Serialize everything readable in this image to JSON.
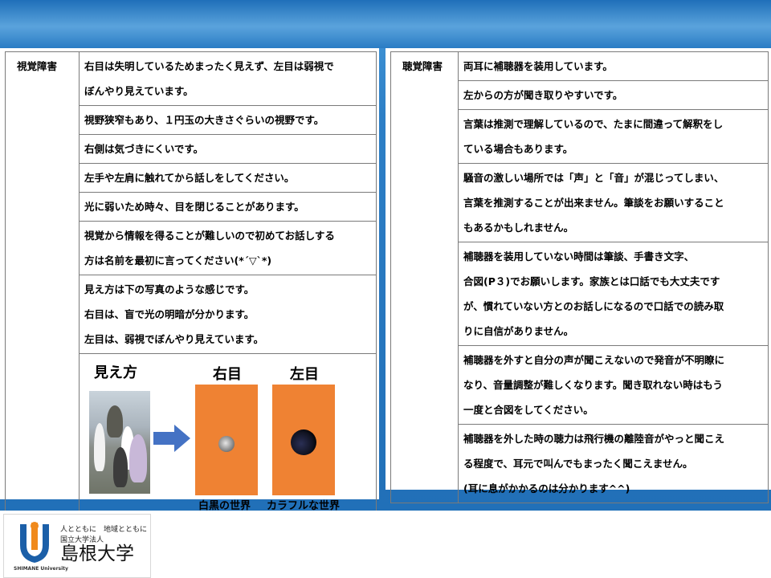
{
  "left_table": {
    "header": "視覚障害",
    "rows": [
      {
        "lines": [
          "右目は失明しているためまったく見えず、左目は弱視で",
          "ぼんやり見えています。"
        ]
      },
      {
        "lines": [
          "視野狭窄もあり、１円玉の大きさぐらいの視野です。"
        ]
      },
      {
        "lines": [
          "右側は気づきにくいです。"
        ]
      },
      {
        "lines": [
          "左手や左肩に触れてから話しをしてください。"
        ]
      },
      {
        "lines": [
          "光に弱いため時々、目を閉じることがあります。"
        ]
      },
      {
        "lines": [
          "視覚から情報を得ることが難しいので初めてお話しする",
          "方は名前を最初に言ってください(*´▽`*)"
        ]
      },
      {
        "lines": [
          "見え方は下の写真のような感じです。",
          "右目は、盲で光の明暗が分かります。",
          "左目は、弱視でぼんやり見えています。"
        ]
      }
    ],
    "illustration": {
      "title": "見え方",
      "right_label": "右目",
      "left_label": "左目",
      "right_caption": "白黒の世界",
      "left_caption": "カラフルな世界",
      "box_color": "#ef8233"
    }
  },
  "right_table": {
    "header": "聴覚障害",
    "rows": [
      {
        "lines": [
          "両耳に補聴器を装用しています。"
        ]
      },
      {
        "lines": [
          "左からの方が聞き取りやすいです。"
        ]
      },
      {
        "lines": [
          "言葉は推測で理解しているので、たまに間違って解釈をし",
          "ている場合もあります。"
        ]
      },
      {
        "lines": [
          "騒音の激しい場所では「声」と「音」が混じってしまい、",
          "言葉を推測することが出来ません。筆談をお願いすること",
          "もあるかもしれません。"
        ]
      },
      {
        "lines": [
          "補聴器を装用していない時間は筆談、手書き文字、",
          "合図(P３)でお願いします。家族とは口話でも大丈夫です",
          "が、慣れていない方とのお話しになるので口話での読み取",
          "りに自信がありません。"
        ]
      },
      {
        "lines": [
          "補聴器を外すと自分の声が聞こえないので発音が不明瞭に",
          "なり、音量調整が難しくなります。聞き取れない時はもう",
          "一度と合図をしてください。"
        ]
      },
      {
        "lines": [
          "補聴器を外した時の聴力は飛行機の離陸音がやっと聞こえ",
          "る程度で、耳元で叫んでもまったく聞こえません。",
          "(耳に息がかかるのは分かります^^)"
        ]
      }
    ]
  },
  "logo": {
    "tagline": "人とともに　地域とともに",
    "org_type": "国立大学法人",
    "name": "島根大学",
    "english": "SHIMANE University"
  },
  "colors": {
    "background_blue": "#1f6db5",
    "accent_orange": "#ef8233",
    "logo_blue": "#1b5fa8",
    "logo_orange": "#f08a1c"
  }
}
